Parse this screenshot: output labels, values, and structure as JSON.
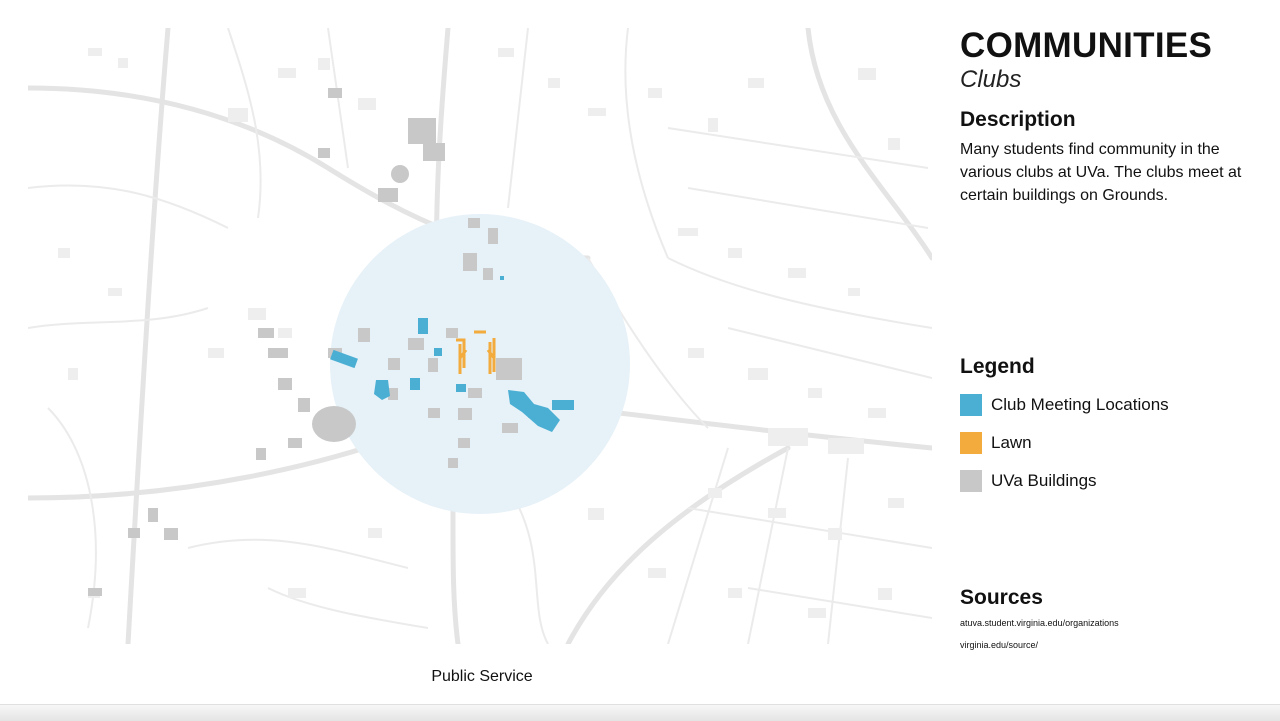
{
  "header": {
    "title": "COMMUNITIES",
    "subtitle": "Clubs"
  },
  "description": {
    "heading": "Description",
    "text": "Many students find community in the various clubs at UVa. The clubs meet at certain buildings on Grounds."
  },
  "legend": {
    "heading": "Legend",
    "items": [
      {
        "label": "Club Meeting Locations",
        "color": "#4bafd3"
      },
      {
        "label": "Lawn",
        "color": "#f2ab3c"
      },
      {
        "label": "UVa Buildings",
        "color": "#c8c8c8"
      }
    ]
  },
  "sources": {
    "heading": "Sources",
    "items": [
      "atuva.student.virginia.edu/organizations",
      "virginia.edu/source/"
    ]
  },
  "caption": "Public Service",
  "map_colors": {
    "background": "#ffffff",
    "roads": "#e6e6e6",
    "footprints": "#eeeeee",
    "buffer": "#e6f1f8",
    "club": "#4bafd3",
    "lawn": "#f2ab3c",
    "buildings": "#c8c8c8"
  }
}
